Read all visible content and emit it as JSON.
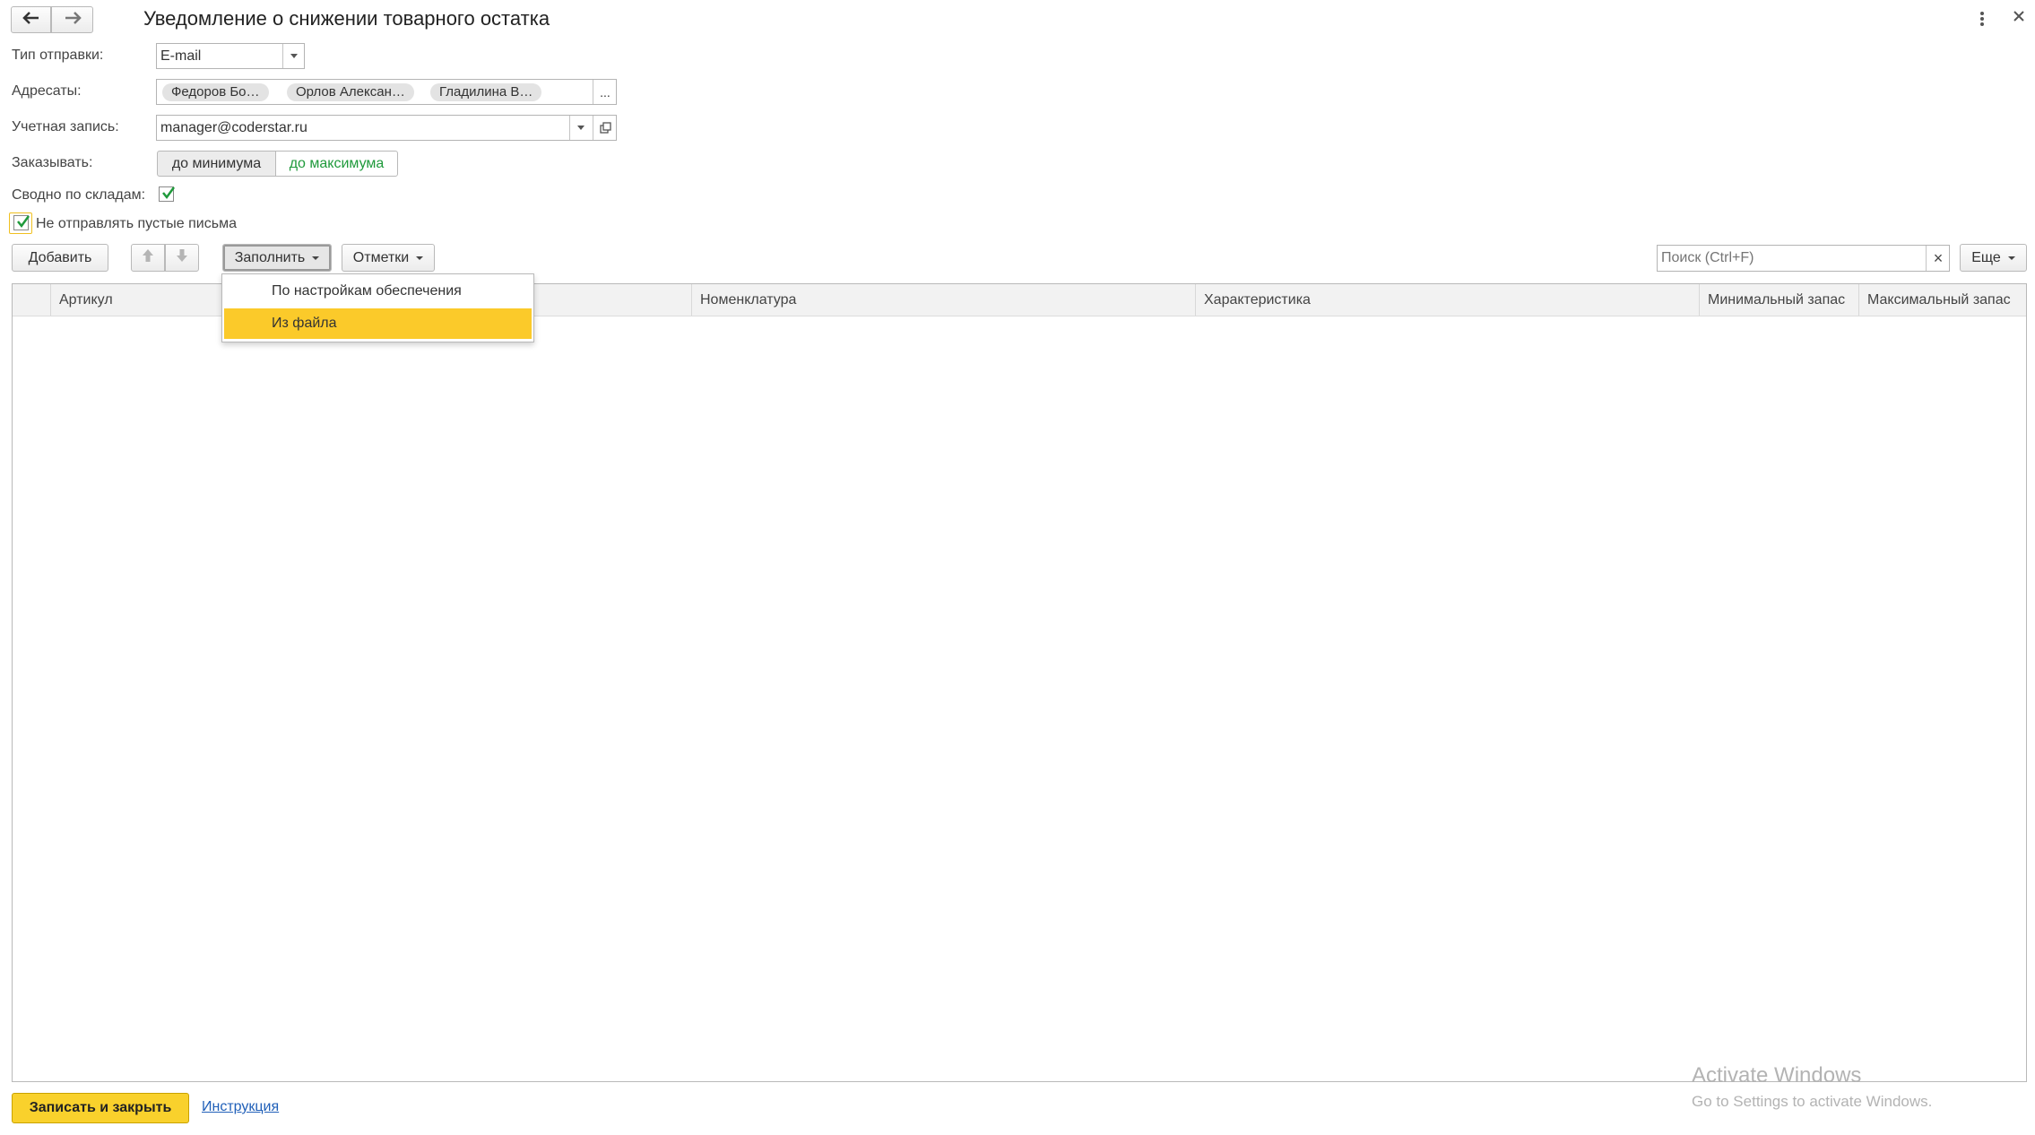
{
  "nav": {
    "back_icon": "arrow-left-icon",
    "forward_icon": "arrow-right-icon"
  },
  "window": {
    "title": "Уведомление о снижении товарного остатка",
    "menu_icon": "more-vertical-icon",
    "close_icon": "close-icon"
  },
  "form": {
    "send_type": {
      "label": "Тип отправки:",
      "value": "E-mail"
    },
    "recipients": {
      "label": "Адресаты:",
      "chips": [
        "Федоров Бо…",
        "Орлов Алексан…",
        "Гладилина В…"
      ],
      "more_label": "..."
    },
    "account": {
      "label": "Учетная запись:",
      "value": "manager@coderstar.ru"
    },
    "order": {
      "label": "Заказывать:",
      "options": [
        "до минимума",
        "до максимума"
      ],
      "selected": "до максимума"
    },
    "by_warehouses": {
      "label": "Сводно по складам:",
      "checked": true
    },
    "skip_empty": {
      "label": "Не отправлять пустые письма",
      "checked": true
    }
  },
  "toolbar": {
    "add_label": "Добавить",
    "up_icon": "arrow-up-icon",
    "down_icon": "arrow-down-icon",
    "fill_label": "Заполнить",
    "marks_label": "Отметки",
    "search_placeholder": "Поиск (Ctrl+F)",
    "search_clear": "×",
    "more_label": "Еще"
  },
  "fill_menu": {
    "items": [
      "По настройкам обеспечения",
      "Из файла"
    ],
    "highlighted": "Из файла"
  },
  "table": {
    "columns": [
      "Артикул",
      "Номенклатура",
      "Характеристика",
      "Минимальный запас",
      "Максимальный запас"
    ],
    "rows": []
  },
  "footer": {
    "save_close_label": "Записать и закрыть",
    "instruction_label": "Инструкция"
  },
  "watermark": {
    "line1": "Activate Windows",
    "line2": "Go to Settings to activate Windows."
  },
  "colors": {
    "accent_yellow": "#f9d12c",
    "menu_highlight": "#fbca2a",
    "green_text": "#1f9a3b",
    "link": "#1f5fb8"
  }
}
